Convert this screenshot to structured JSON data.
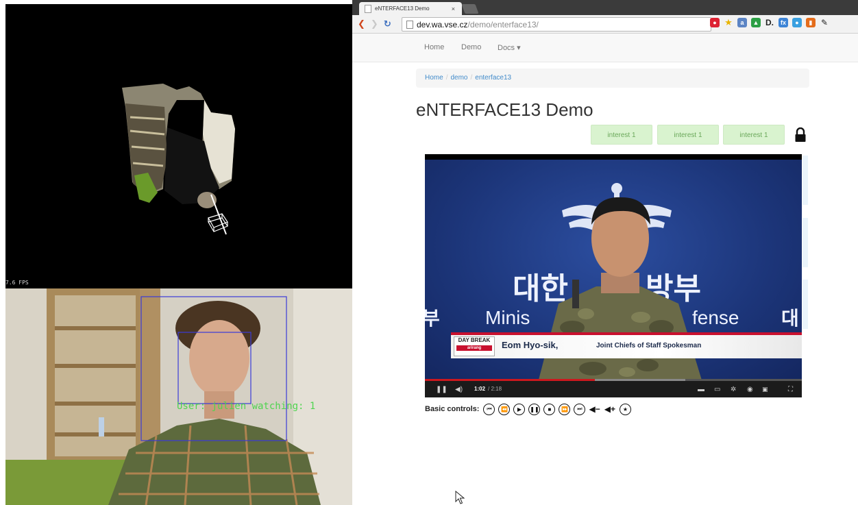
{
  "left": {
    "fps_text": "7.6 FPS",
    "user_label": "User: julien watching: 1"
  },
  "browser": {
    "tab": {
      "title": "eNTERFACE13 Demo",
      "close": "×"
    },
    "url": {
      "host": "dev.wa.vse.cz",
      "path": "/demo/enterface13/"
    },
    "navbar": {
      "home": "Home",
      "demo": "Demo",
      "docs": "Docs ▾"
    },
    "breadcrumb": {
      "home": "Home",
      "demo": "demo",
      "current": "enterface13",
      "sep": "/"
    },
    "page_title": "eNTERFACE13 Demo",
    "interest_badges": [
      "interest 1",
      "interest 1",
      "interest 1"
    ],
    "video": {
      "korean_left": "대한",
      "korean_right": "방부",
      "korean_edge_left": "부",
      "korean_edge_right": "대",
      "ministry_left": "Minis",
      "ministry_right": "fense",
      "daybreak": "DAY BREAK",
      "daybreak_brand": "arirang",
      "speaker_name": "Eom Hyo-sik,",
      "speaker_role": "Joint Chiefs of Staff Spokesman",
      "time_current": "1:02",
      "time_total": "/ 2:18",
      "progress_played": 0.45,
      "progress_buffered": 0.69
    },
    "basic_controls_label": "Basic controls:",
    "colors": {
      "accent_link": "#428bca",
      "interest_bg": "#d9f3cf",
      "progress_red": "#cc181e"
    }
  }
}
